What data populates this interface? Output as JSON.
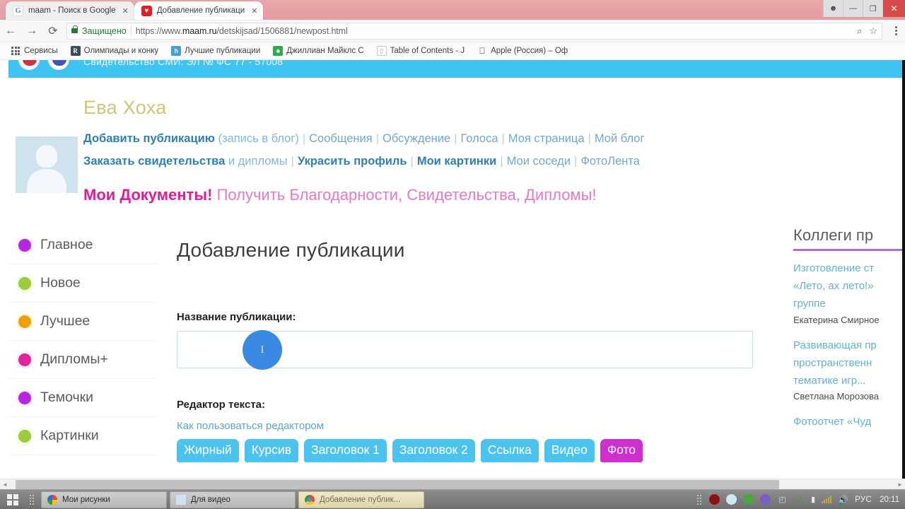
{
  "browser": {
    "tabs": [
      {
        "title": "maam - Поиск в Google",
        "icon": "google-favicon",
        "active": false,
        "close": "✕"
      },
      {
        "title": "Добавление публикаци",
        "icon": "maam-favicon",
        "active": true,
        "close": "✕"
      }
    ],
    "window_controls": {
      "minimize": "—",
      "maximize": "❐",
      "close": "✕",
      "user": "👤"
    },
    "nav": {
      "back": "←",
      "forward": "→",
      "reload": "⟳"
    },
    "omnibox": {
      "secure_label": "Защищено",
      "url_prefix": "https://www.",
      "url_domain": "maam.ru",
      "url_path": "/detskijsad/1506881/newpost.html",
      "full_url": "https://www.maam.ru/detskijsad/1506881/newpost.html",
      "zoom_icon": "search-icon",
      "bookmark_icon": "star-icon"
    },
    "bookmarks": [
      {
        "label": "Сервисы",
        "icon": "apps-grid-icon"
      },
      {
        "label": "Олимпиады и конку",
        "icon": "olympiad-icon",
        "glyph": "R"
      },
      {
        "label": "Лучшие публикации",
        "icon": "publications-icon",
        "glyph": "h"
      },
      {
        "label": "Джиллиан Майклс С",
        "icon": "person-icon",
        "glyph": "♣"
      },
      {
        "label": "Table of Contents - J",
        "icon": "document-icon",
        "glyph": "▯"
      },
      {
        "label": "Apple (Россия) – Оф",
        "icon": "apple-icon",
        "glyph": ""
      }
    ]
  },
  "page": {
    "banner": {
      "text": "Свидетельство СМИ: ЭЛ № ФС 77 - 57008"
    },
    "user": {
      "name": "Ева Хоха",
      "avatar_alt": "avatar-placeholder",
      "nav_row1": [
        {
          "text": "Добавить публикацию",
          "style": "strong"
        },
        {
          "text": "(запись в блог)",
          "style": "soft"
        },
        {
          "text": "Сообщения",
          "style": "plain"
        },
        {
          "text": "Обсуждение",
          "style": "plain"
        },
        {
          "text": "Голоса",
          "style": "plain"
        },
        {
          "text": "Моя страница",
          "style": "plain"
        },
        {
          "text": "Мой блог",
          "style": "plain"
        }
      ],
      "nav_row2": [
        {
          "text": "Заказать свидетельства",
          "style": "strong"
        },
        {
          "text": "и дипломы",
          "style": "soft"
        },
        {
          "text": "Украсить профиль",
          "style": "strong"
        },
        {
          "text": "Мои картинки",
          "style": "strong"
        },
        {
          "text": "Мои соседи",
          "style": "plain"
        },
        {
          "text": "ФотоЛента",
          "style": "plain"
        }
      ],
      "documents_bold": "Мои Документы!",
      "documents_rest": "Получить Благодарности, Свидетельства, Дипломы!"
    },
    "sidebar": {
      "items": [
        {
          "label": "Главное",
          "color": "#b429e0"
        },
        {
          "label": "Новое",
          "color": "#9ccb3b"
        },
        {
          "label": "Лучшее",
          "color": "#f0a000"
        },
        {
          "label": "Дипломы+",
          "color": "#e0249a"
        },
        {
          "label": "Темочки",
          "color": "#b429e0"
        },
        {
          "label": "Картинки",
          "color": "#9ccb3b"
        }
      ]
    },
    "main": {
      "title": "Добавление публикации",
      "title_field_label": "Название публикации:",
      "title_field_value": "",
      "title_field_placeholder": "",
      "editor_label": "Редактор текста:",
      "editor_help_link": "Как пользоваться редактором",
      "editor_buttons": [
        {
          "label": "Жирный",
          "color": "#4cc3ef"
        },
        {
          "label": "Курсив",
          "color": "#4cc3ef"
        },
        {
          "label": "Заголовок 1",
          "color": "#4cc3ef"
        },
        {
          "label": "Заголовок 2",
          "color": "#4cc3ef"
        },
        {
          "label": "Ссылка",
          "color": "#4cc3ef"
        },
        {
          "label": "Видео",
          "color": "#4cc3ef"
        },
        {
          "label": "Фото",
          "color": "#cf2fd0"
        }
      ],
      "cursor_indicator": "I"
    },
    "right_sidebar": {
      "title": "Коллеги пр",
      "items": [
        {
          "lines": [
            "Изготовление ст",
            "«Лето, ах лето!»",
            "группе"
          ],
          "author": "Екатерина Смирное"
        },
        {
          "lines": [
            "Развивающая пр",
            "пространственн",
            "тематике игр..."
          ],
          "author": "Светлана Морозова"
        },
        {
          "lines": [
            "Фотоотчет «Чуд"
          ],
          "author": ""
        }
      ]
    }
  },
  "taskbar": {
    "start_label": "start-button",
    "items": [
      {
        "label": "Мои рисунки",
        "icon": "pictures-icon",
        "active": false
      },
      {
        "label": "Для видео",
        "icon": "video-icon",
        "active": false
      },
      {
        "label": "Добавление публик...",
        "icon": "chrome-icon",
        "active": true
      }
    ],
    "tray": {
      "icons": [
        "record-icon",
        "cloud-icon",
        "nvidia-icon",
        "heart-icon",
        "shield-icon",
        "antivirus-icon",
        "battery-icon",
        "signal-icon",
        "volume-icon"
      ],
      "language": "РУС",
      "clock": "20:11"
    }
  }
}
